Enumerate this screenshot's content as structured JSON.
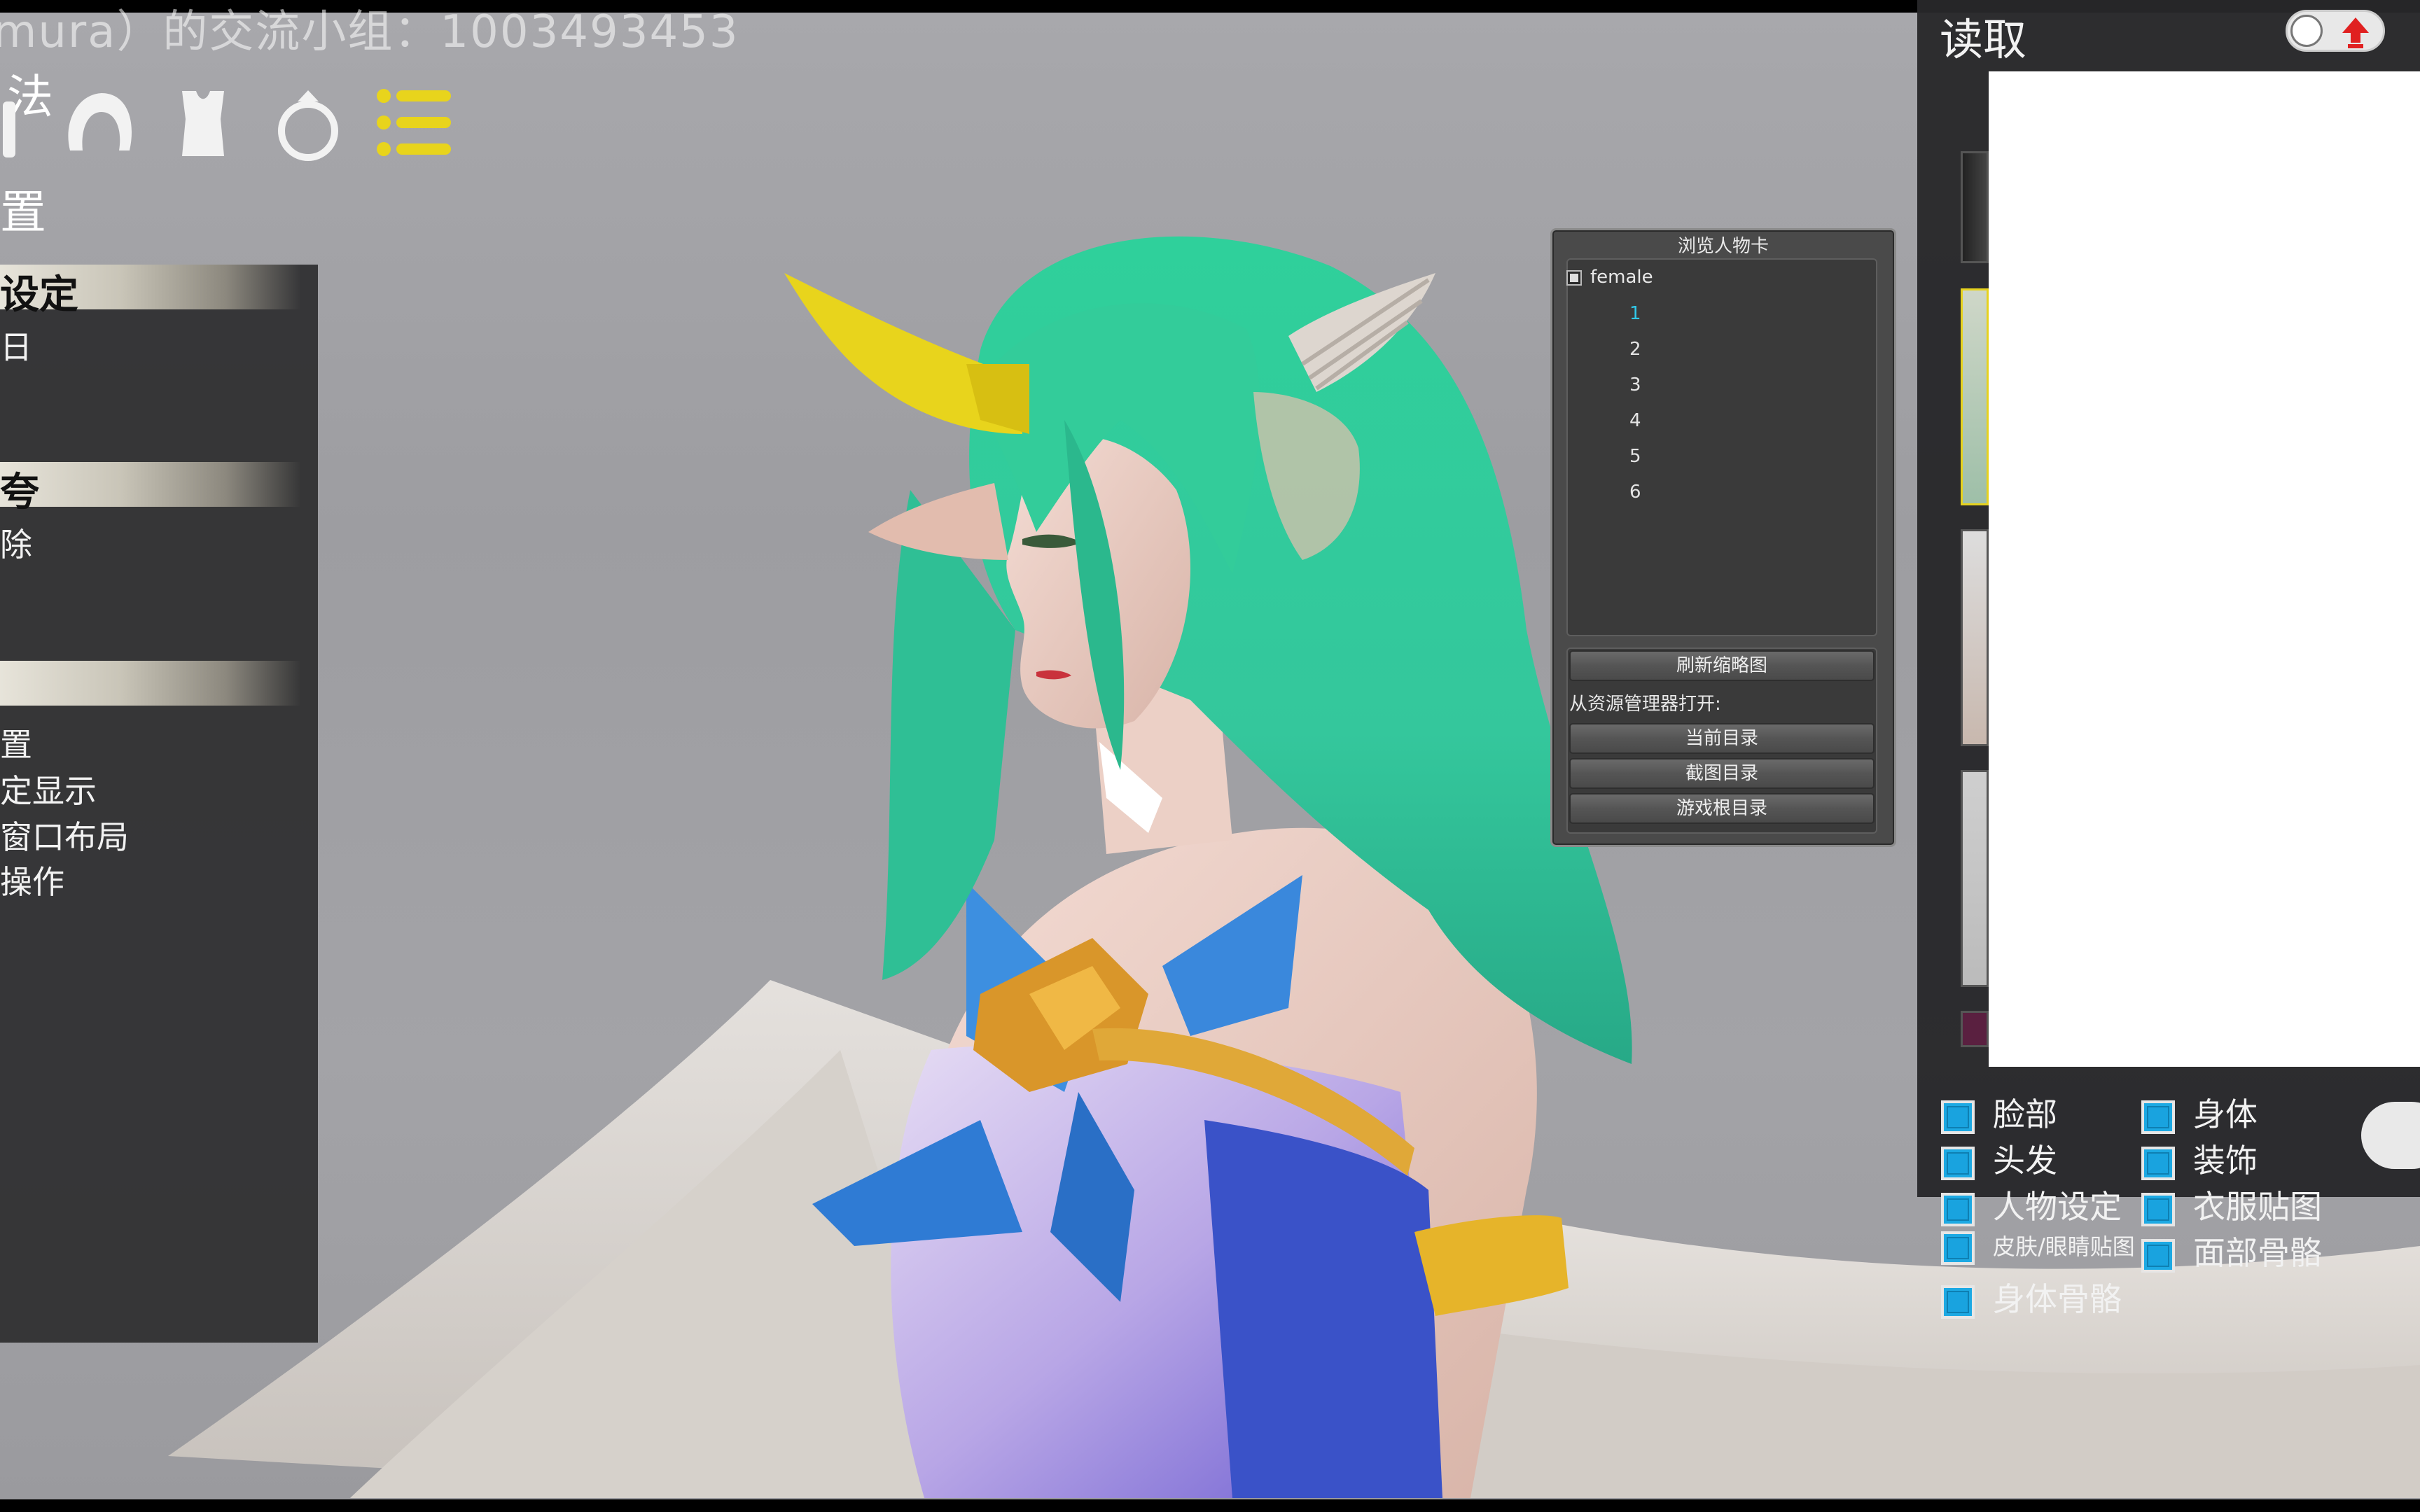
{
  "watermark": "mura）的交流小组：1003493453",
  "left_toolbar": {
    "lead_char": "法",
    "icons": [
      "person-icon",
      "hair-icon",
      "clothing-icon",
      "ring-icon",
      "list-icon"
    ],
    "section_char": "置"
  },
  "left_panel": {
    "sections": [
      {
        "header": "设定",
        "items": [
          "日"
        ]
      },
      {
        "header": "",
        "items": [
          "除"
        ]
      },
      {
        "header": "",
        "items": [
          "置",
          "定显示",
          "窗口布局",
          "操作"
        ]
      }
    ],
    "lone_char": "夸"
  },
  "browse_window": {
    "title": "浏览人物卡",
    "root": "female",
    "nodes": [
      "1",
      "2",
      "3",
      "4",
      "5",
      "6"
    ],
    "active_node": "1",
    "refresh_button": "刷新缩略图",
    "open_from_label": "从资源管理器打开:",
    "buttons": [
      "当前目录",
      "截图目录",
      "游戏根目录"
    ]
  },
  "right_panel": {
    "title": "读取",
    "toggle_icon": "upload-arrow-icon",
    "checkboxes": [
      {
        "label": "脸部",
        "checked": true
      },
      {
        "label": "身体",
        "checked": true
      },
      {
        "label": "头发",
        "checked": true
      },
      {
        "label": "装饰",
        "checked": true
      },
      {
        "label": "人物设定",
        "checked": true
      },
      {
        "label": "衣服贴图",
        "checked": true
      },
      {
        "label": "皮肤/眼睛贴图",
        "checked": true
      },
      {
        "label": "面部骨骼",
        "checked": true
      },
      {
        "label": "身体骨骼",
        "checked": true
      }
    ]
  },
  "colors": {
    "accent_blue": "#1da9e3",
    "hair_green": "#35c79a",
    "horn_yellow": "#e6d21e",
    "active_node": "#31c8e8"
  }
}
